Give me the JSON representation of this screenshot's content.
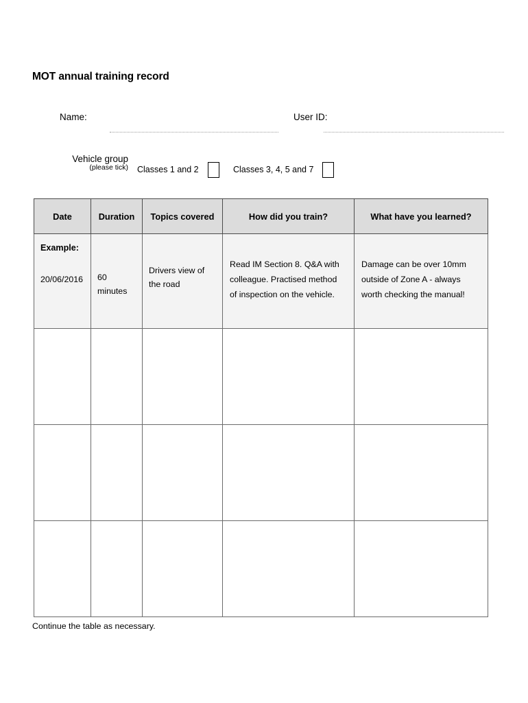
{
  "document": {
    "title": "MOT annual training record",
    "footer_note": "Continue the table as necessary."
  },
  "fields": {
    "name_label": "Name:",
    "name_value": "",
    "user_id_label": "User ID:",
    "user_id_value": ""
  },
  "vehicle_group": {
    "label": "Vehicle group",
    "sub_label": "(please tick)",
    "options": [
      {
        "label": "Classes 1 and 2",
        "checked": false
      },
      {
        "label": "Classes 3, 4, 5 and 7",
        "checked": false
      }
    ]
  },
  "table": {
    "headers": [
      "Date",
      "Duration",
      "Topics covered",
      "How did you train?",
      "What have you learned?"
    ],
    "example_row": {
      "example_label": "Example:",
      "date": "20/06/2016",
      "duration": "60 minutes",
      "topics": "Drivers view of the road",
      "how": "Read IM Section 8. Q&A with colleague. Practised method of inspection on the vehicle.",
      "learned": "Damage can be over 10mm outside of Zone A - always worth checking the manual!"
    },
    "blank_rows": [
      {
        "date": "",
        "duration": "",
        "topics": "",
        "how": "",
        "learned": ""
      },
      {
        "date": "",
        "duration": "",
        "topics": "",
        "how": "",
        "learned": ""
      },
      {
        "date": "",
        "duration": "",
        "topics": "",
        "how": "",
        "learned": ""
      }
    ]
  },
  "colors": {
    "header_fill": "#dcdcdc",
    "example_fill": "#f3f3f3",
    "border": "#6b6b6b",
    "text": "#000000"
  }
}
